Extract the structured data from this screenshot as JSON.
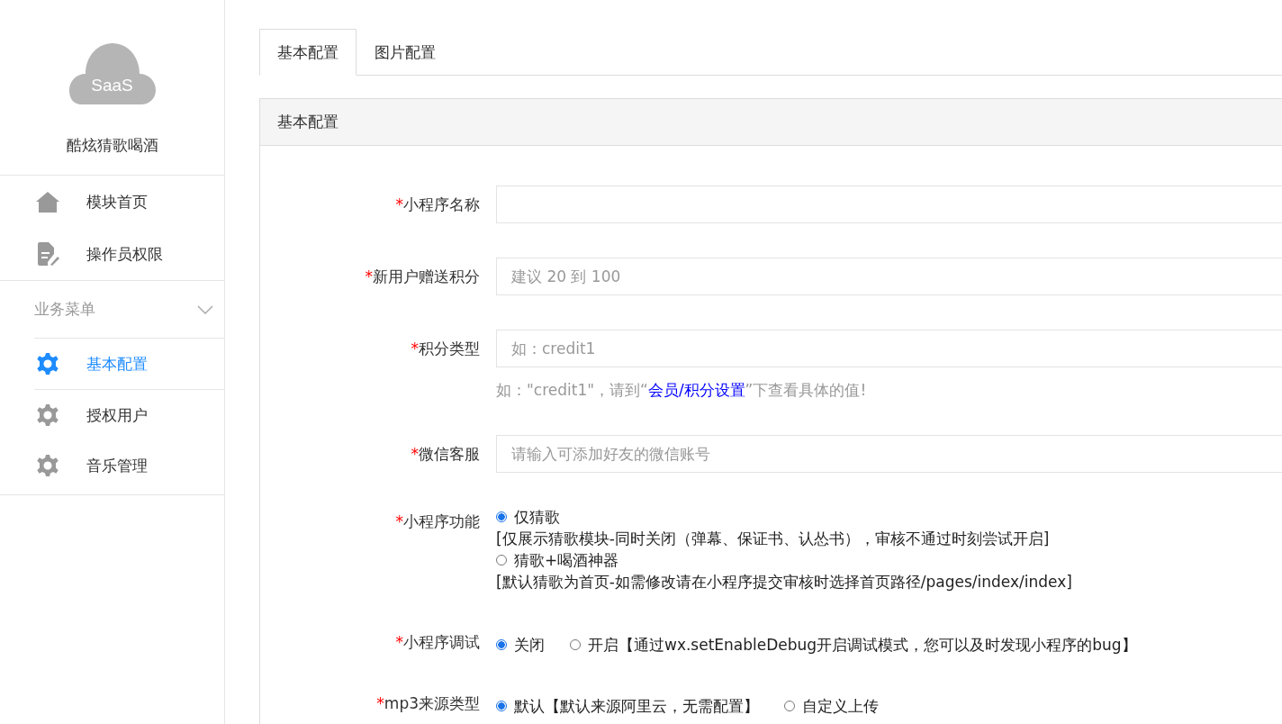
{
  "sidebar": {
    "logo_text": "SaaS",
    "app_name": "酷炫猜歌喝酒",
    "top_items": [
      {
        "label": "模块首页",
        "selected": false
      },
      {
        "label": "操作员权限",
        "selected": false
      }
    ],
    "section": {
      "title": "业务菜单",
      "expanded": true,
      "items": [
        {
          "label": "基本配置",
          "selected": true
        },
        {
          "label": "授权用户",
          "selected": false
        },
        {
          "label": "音乐管理",
          "selected": false
        }
      ]
    }
  },
  "tabs": [
    {
      "label": "基本配置",
      "selected": true
    },
    {
      "label": "图片配置",
      "selected": false
    }
  ],
  "panel": {
    "title": "基本配置",
    "rows": [
      {
        "kind": "input",
        "mark": "*",
        "label": "小程序名称"
      },
      {
        "kind": "input",
        "mark": "*",
        "label": "新用户赠送积分",
        "placeholder": "建议 20 到 100"
      },
      {
        "kind": "input",
        "mark": "*",
        "label": "积分类型",
        "placeholder": "如：credit1",
        "help": {
          "before": "如：\"credit1\"，请到“",
          "link": "会员/积分设置",
          "after": "”下查看具体的值!"
        }
      },
      {
        "kind": "input",
        "mark": "*",
        "label": "微信客服",
        "placeholder": "请输入可添加好友的微信账号"
      },
      {
        "kind": "radio",
        "mark": "*",
        "label": "小程序功能",
        "options": [
          {
            "label": "仅猜歌",
            "selected": true,
            "note": "[仅展示猜歌模块-同时关闭（弹幕、保证书、认怂书），审核不通过时刻尝试开启]"
          },
          {
            "label": "猜歌+喝酒神器",
            "selected": false,
            "note": "[默认猜歌为首页-如需修改请在小程序提交审核时选择首页路径/pages/index/index]"
          }
        ]
      },
      {
        "kind": "radio",
        "mark": "*",
        "label": "小程序调试",
        "options": [
          {
            "label": "关闭",
            "selected": true
          },
          {
            "label": "开启【通过wx.setEnableDebug开启调试模式，您可以及时发现小程序的bug】",
            "selected": false
          }
        ]
      },
      {
        "kind": "radio",
        "mark": "*",
        "label": "mp3来源类型",
        "options": [
          {
            "label": "默认【默认来源阿里云，无需配置】",
            "selected": true
          },
          {
            "label": "自定义上传",
            "selected": false
          }
        ]
      }
    ]
  }
}
